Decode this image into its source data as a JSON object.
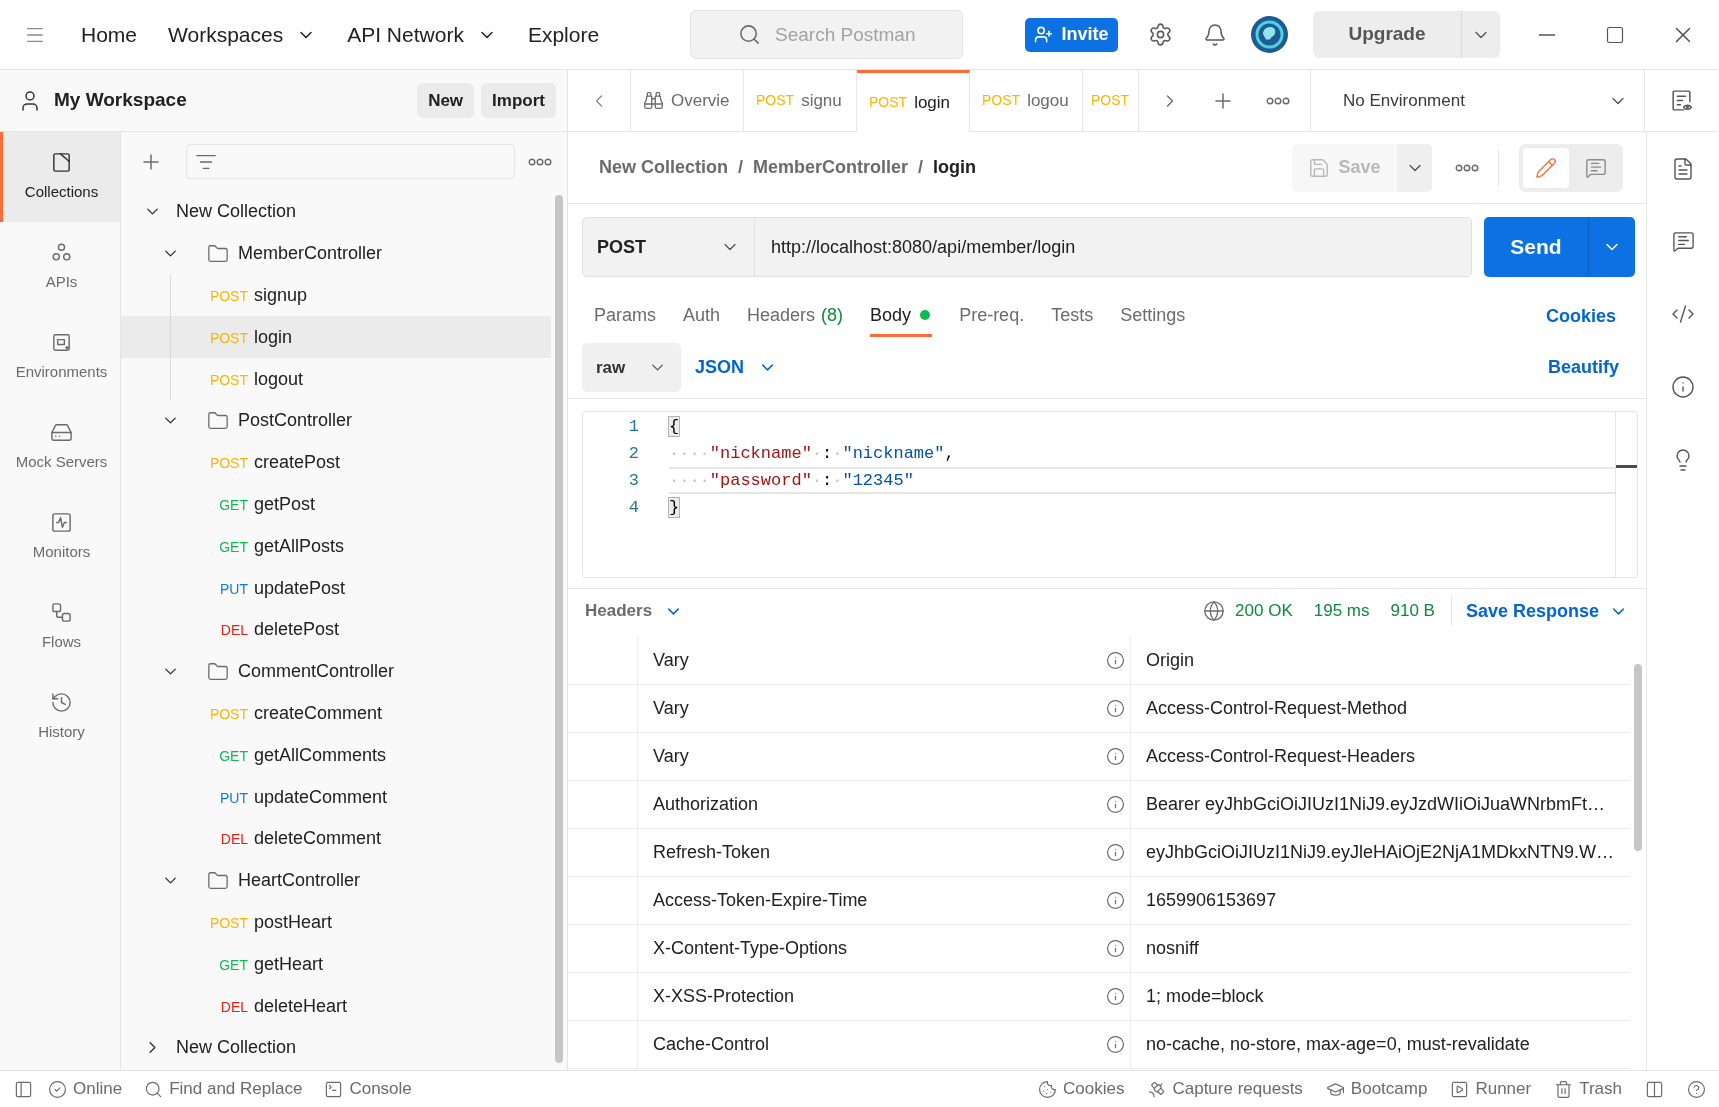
{
  "title_bar": {
    "nav": [
      {
        "label": "Home",
        "has_menu": false
      },
      {
        "label": "Workspaces",
        "has_menu": true
      },
      {
        "label": "API Network",
        "has_menu": true
      },
      {
        "label": "Explore",
        "has_menu": false
      }
    ],
    "search": {
      "placeholder": "Search Postman"
    },
    "invite": "Invite",
    "upgrade": "Upgrade"
  },
  "workspace": {
    "title": "My Workspace",
    "buttons": [
      "New",
      "Import"
    ]
  },
  "tabs": [
    {
      "kind": "overview",
      "label": "Overvie",
      "selected": false
    },
    {
      "kind": "request",
      "method": "POST",
      "color": "#ffb400",
      "label": "signu",
      "selected": false
    },
    {
      "kind": "request",
      "method": "POST",
      "color": "#ffb400",
      "label": "login",
      "selected": true
    },
    {
      "kind": "request",
      "method": "POST",
      "color": "#ffb400",
      "label": "logou",
      "selected": false
    },
    {
      "kind": "request",
      "method": "POST",
      "color": "#ffb400",
      "selected": false
    }
  ],
  "environment": {
    "label": "No Environment"
  },
  "rail": [
    {
      "kind": "collections",
      "label": "Collections",
      "selected": true
    },
    {
      "kind": "apis",
      "label": "APIs",
      "selected": false
    },
    {
      "kind": "environments",
      "label": "Environments",
      "selected": false
    },
    {
      "kind": "mock_servers",
      "label": "Mock Servers",
      "selected": false
    },
    {
      "kind": "monitors",
      "label": "Monitors",
      "selected": false
    },
    {
      "kind": "flows",
      "label": "Flows",
      "selected": false
    },
    {
      "kind": "history",
      "label": "History",
      "selected": false
    }
  ],
  "tree": [
    {
      "kind": "collection",
      "label": "New Collection",
      "expanded": true,
      "children": [
        {
          "kind": "folder",
          "label": "MemberController",
          "expanded": true,
          "children": [
            {
              "kind": "request",
              "method": "POST",
              "color": "#ffb400",
              "label": "signup",
              "selected": false
            },
            {
              "kind": "request",
              "method": "POST",
              "color": "#ffb400",
              "label": "login",
              "selected": true
            },
            {
              "kind": "request",
              "method": "POST",
              "color": "#ffb400",
              "label": "logout",
              "selected": false
            }
          ]
        },
        {
          "kind": "folder",
          "label": "PostController",
          "expanded": true,
          "children": [
            {
              "kind": "request",
              "method": "POST",
              "color": "#ffb400",
              "label": "createPost",
              "selected": false
            },
            {
              "kind": "request",
              "method": "GET",
              "color": "#0cbb52",
              "label": "getPost",
              "selected": false
            },
            {
              "kind": "request",
              "method": "GET",
              "color": "#0cbb52",
              "label": "getAllPosts",
              "selected": false
            },
            {
              "kind": "request",
              "method": "PUT",
              "color": "#097bed",
              "label": "updatePost",
              "selected": false
            },
            {
              "kind": "request",
              "method": "DEL",
              "color": "#eb2013",
              "label": "deletePost",
              "selected": false
            }
          ]
        },
        {
          "kind": "folder",
          "label": "CommentController",
          "expanded": true,
          "children": [
            {
              "kind": "request",
              "method": "POST",
              "color": "#ffb400",
              "label": "createComment",
              "selected": false
            },
            {
              "kind": "request",
              "method": "GET",
              "color": "#0cbb52",
              "label": "getAllComments",
              "selected": false
            },
            {
              "kind": "request",
              "method": "PUT",
              "color": "#097bed",
              "label": "updateComment",
              "selected": false
            },
            {
              "kind": "request",
              "method": "DEL",
              "color": "#eb2013",
              "label": "deleteComment",
              "selected": false
            }
          ]
        },
        {
          "kind": "folder",
          "label": "HeartController",
          "expanded": true,
          "children": [
            {
              "kind": "request",
              "method": "POST",
              "color": "#ffb400",
              "label": "postHeart",
              "selected": false
            },
            {
              "kind": "request",
              "method": "GET",
              "color": "#0cbb52",
              "label": "getHeart",
              "selected": false
            },
            {
              "kind": "request",
              "method": "DEL",
              "color": "#eb2013",
              "label": "deleteHeart",
              "selected": false
            }
          ]
        }
      ]
    },
    {
      "kind": "collection",
      "label": "New Collection",
      "expanded": false
    }
  ],
  "breadcrumb": [
    {
      "label": "New Collection",
      "separator": "/"
    },
    {
      "label": "MemberController",
      "separator": "/"
    },
    {
      "label": "login"
    }
  ],
  "save": {
    "label": "Save",
    "disabled": true
  },
  "view_modes": [
    {
      "kind": "edit",
      "selected": true
    },
    {
      "kind": "comments",
      "selected": false
    }
  ],
  "request": {
    "method": "POST",
    "url": "http://localhost:8080/api/member/login",
    "send": "Send"
  },
  "request_tabs": [
    {
      "label": "Params",
      "selected": false,
      "has_content": false
    },
    {
      "label": "Auth",
      "selected": false,
      "has_content": false
    },
    {
      "label": "Headers",
      "count": "(8)",
      "selected": false,
      "has_content": false
    },
    {
      "label": "Body",
      "selected": true,
      "has_content": true
    },
    {
      "label": "Pre-req.",
      "selected": false,
      "has_content": false
    },
    {
      "label": "Tests",
      "selected": false,
      "has_content": false
    },
    {
      "label": "Settings",
      "selected": false,
      "has_content": false
    }
  ],
  "cookies_link": "Cookies",
  "body": {
    "mode": "raw",
    "language": "JSON",
    "beautify": "Beautify",
    "lines": [
      {
        "number": "1",
        "current": false,
        "tokens": [
          {
            "kind": "bracket",
            "text": "{"
          }
        ]
      },
      {
        "number": "2",
        "current": false,
        "tokens": [
          {
            "kind": "space",
            "text": "····"
          },
          {
            "kind": "key",
            "text": "\"nickname\""
          },
          {
            "kind": "space",
            "text": "·"
          },
          {
            "kind": "punct",
            "text": ":"
          },
          {
            "kind": "space",
            "text": "·"
          },
          {
            "kind": "string",
            "text": "\"nickname\""
          },
          {
            "kind": "punct",
            "text": ","
          }
        ]
      },
      {
        "number": "3",
        "current": true,
        "tokens": [
          {
            "kind": "space",
            "text": "····"
          },
          {
            "kind": "key",
            "text": "\"password\""
          },
          {
            "kind": "space",
            "text": "·"
          },
          {
            "kind": "punct",
            "text": ":"
          },
          {
            "kind": "space",
            "text": "·"
          },
          {
            "kind": "string",
            "text": "\"12345\""
          }
        ]
      },
      {
        "number": "4",
        "current": false,
        "tokens": [
          {
            "kind": "bracket",
            "text": "}"
          }
        ]
      }
    ]
  },
  "response": {
    "section": "Headers",
    "status": "200 OK",
    "time": "195 ms",
    "size": "910 B",
    "save": "Save Response",
    "headers": [
      {
        "key": "Vary",
        "value": "Origin"
      },
      {
        "key": "Vary",
        "value": "Access-Control-Request-Method"
      },
      {
        "key": "Vary",
        "value": "Access-Control-Request-Headers"
      },
      {
        "key": "Authorization",
        "value": "Bearer eyJhbGciOiJIUzI1NiJ9.eyJzdWIiOiJuaWNrbmFt…"
      },
      {
        "key": "Refresh-Token",
        "value": "eyJhbGciOiJIUzI1NiJ9.eyJleHAiOjE2NjA1MDkxNTN9.W…"
      },
      {
        "key": "Access-Token-Expire-Time",
        "value": "1659906153697"
      },
      {
        "key": "X-Content-Type-Options",
        "value": "nosniff"
      },
      {
        "key": "X-XSS-Protection",
        "value": "1; mode=block"
      },
      {
        "key": "Cache-Control",
        "value": "no-cache, no-store, max-age=0, must-revalidate"
      }
    ]
  },
  "status_bar": {
    "left": [
      {
        "kind": "online",
        "label": "Online"
      },
      {
        "kind": "find",
        "label": "Find and Replace"
      },
      {
        "kind": "console",
        "label": "Console"
      }
    ],
    "right": [
      {
        "kind": "cookies",
        "label": "Cookies"
      },
      {
        "kind": "capture",
        "label": "Capture requests"
      },
      {
        "kind": "bootcamp",
        "label": "Bootcamp"
      },
      {
        "kind": "runner",
        "label": "Runner"
      },
      {
        "kind": "trash",
        "label": "Trash"
      }
    ]
  }
}
